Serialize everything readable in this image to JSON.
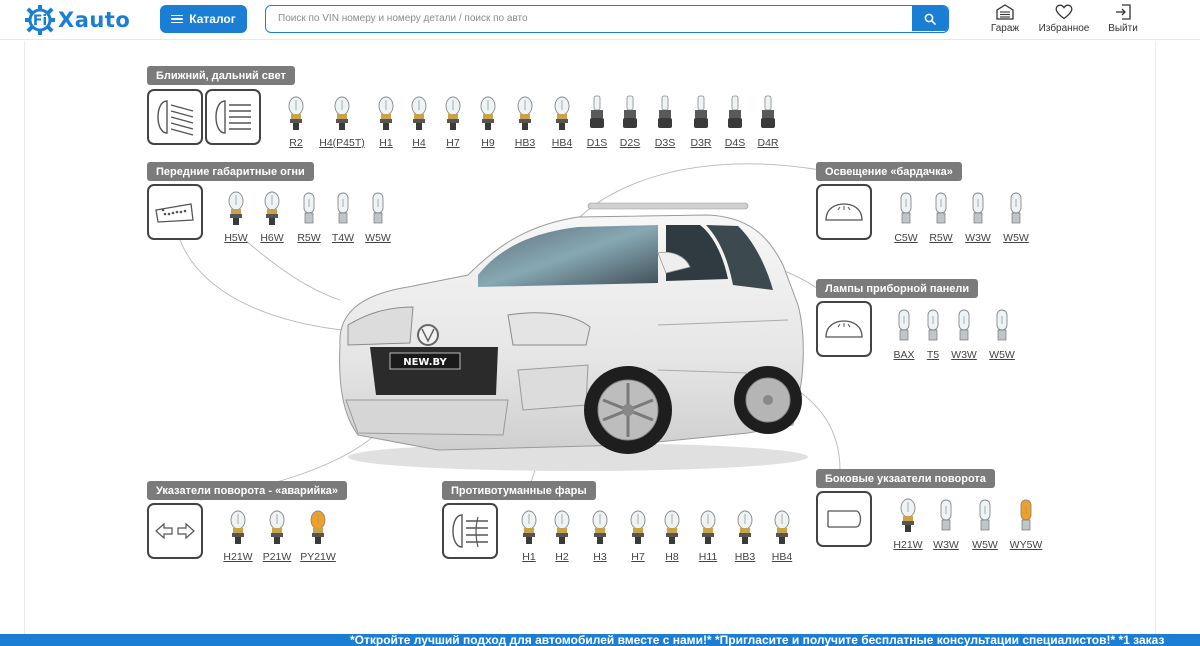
{
  "brand": {
    "logo_text": "Xauto",
    "logo_letter": "Fi"
  },
  "header": {
    "catalog_label": "Каталог",
    "search_placeholder": "Поиск по VIN номеру и номеру детали / поиск по авто",
    "garage_label": "Гараж",
    "favorites_label": "Избранное",
    "logout_label": "Выйти"
  },
  "groups": {
    "low_high": {
      "title": "Ближний, дальний свет",
      "bulbs": [
        "R2",
        "H4(P45T)",
        "H1",
        "H4",
        "H7",
        "H9",
        "HB3",
        "HB4",
        "D1S",
        "D2S",
        "D3S",
        "D3R",
        "D4S",
        "D4R"
      ]
    },
    "front_parking": {
      "title": "Передние габаритные огни",
      "bulbs": [
        "H5W",
        "H6W",
        "R5W",
        "T4W",
        "W5W"
      ]
    },
    "glovebox": {
      "title": "Освещение «бардачка»",
      "bulbs": [
        "C5W",
        "R5W",
        "W3W",
        "W5W"
      ]
    },
    "dashboard": {
      "title": "Лампы приборной панели",
      "bulbs": [
        "BAX",
        "T5",
        "W3W",
        "W5W"
      ]
    },
    "side_turn": {
      "title": "Боковые укзаатели поворота",
      "bulbs": [
        "H21W",
        "W3W",
        "W5W",
        "WY5W"
      ]
    },
    "turn_hazard": {
      "title": "Указатели поворота - «аварийка»",
      "bulbs": [
        "H21W",
        "P21W",
        "PY21W"
      ]
    },
    "fog": {
      "title": "Противотуманные фары",
      "bulbs": [
        "H1",
        "H2",
        "H3",
        "H7",
        "H8",
        "H11",
        "HB3",
        "HB4"
      ]
    }
  },
  "car": {
    "plate_text": "NEW.BY"
  },
  "ticker": {
    "text": "*Откройте лучший подход для автомобилей вместе с нами!* *Пригласите и получите бесплатные консультации специалистов!* *1 заказ"
  },
  "colors": {
    "accent": "#1a7fd4",
    "title_bg": "#7b7b7b",
    "amber": "#e8a020"
  }
}
